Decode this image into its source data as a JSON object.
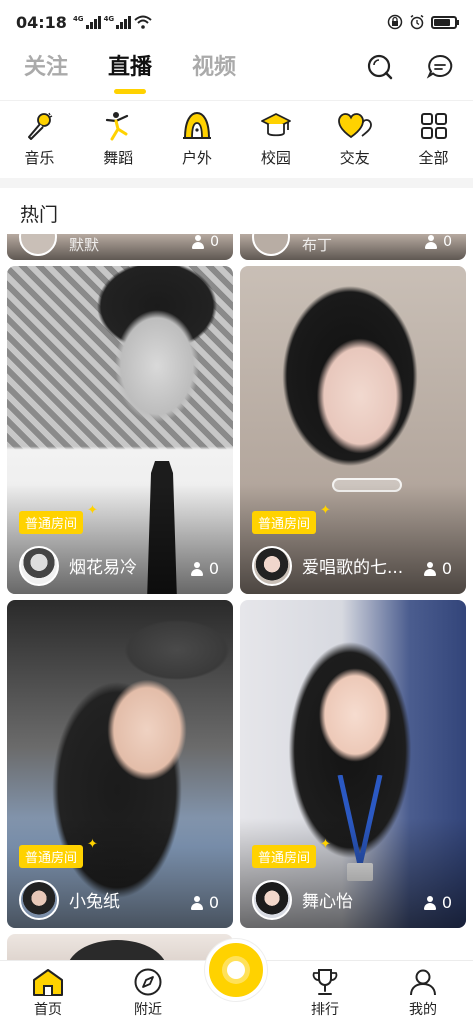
{
  "status_bar": {
    "time": "04:18",
    "net1": "4G",
    "net2": "4G"
  },
  "top_nav": {
    "tabs": [
      {
        "label": "关注",
        "active": false
      },
      {
        "label": "直播",
        "active": true
      },
      {
        "label": "视频",
        "active": false
      }
    ],
    "icons": [
      "search-icon",
      "message-icon"
    ]
  },
  "categories": [
    {
      "label": "音乐",
      "icon": "microphone-icon"
    },
    {
      "label": "舞蹈",
      "icon": "dancer-icon"
    },
    {
      "label": "户外",
      "icon": "tent-icon"
    },
    {
      "label": "校园",
      "icon": "graduation-cap-icon"
    },
    {
      "label": "交友",
      "icon": "hearts-icon"
    },
    {
      "label": "全部",
      "icon": "grid-icon"
    }
  ],
  "section": {
    "title": "热门"
  },
  "partial_row": [
    {
      "name": "默默",
      "viewers": "0"
    },
    {
      "name": "布丁",
      "viewers": "0"
    }
  ],
  "rooms": [
    {
      "badge": "普通房间",
      "name": "烟花易冷",
      "viewers": "0"
    },
    {
      "badge": "普通房间",
      "name": "爱唱歌的七...",
      "viewers": "0"
    },
    {
      "badge": "普通房间",
      "name": "小兔纸",
      "viewers": "0"
    },
    {
      "badge": "普通房间",
      "name": "舞心怡",
      "viewers": "0"
    }
  ],
  "bottom_nav": [
    {
      "label": "首页",
      "icon": "home-icon",
      "active": true
    },
    {
      "label": "附近",
      "icon": "compass-icon",
      "active": false
    },
    {
      "label": "排行",
      "icon": "trophy-icon",
      "active": false
    },
    {
      "label": "我的",
      "icon": "profile-icon",
      "active": false
    }
  ],
  "colors": {
    "accent": "#ffd200",
    "text": "#222222",
    "inactive_tab": "#aaaaaa"
  }
}
